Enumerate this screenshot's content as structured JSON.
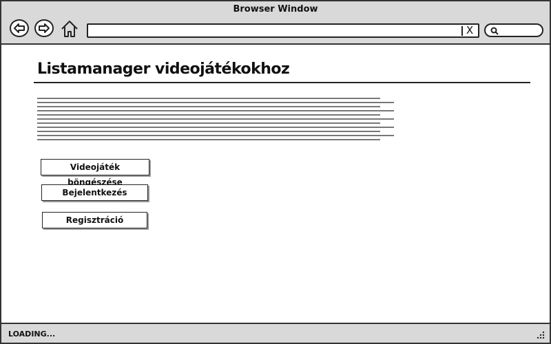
{
  "window": {
    "title": "Browser Window"
  },
  "toolbar": {
    "back_icon": "back-arrow-icon",
    "forward_icon": "forward-arrow-icon",
    "home_icon": "home-icon",
    "address_value": "",
    "clear_label": "X",
    "search_icon": "search-icon"
  },
  "page": {
    "heading": "Listamanager videojátékokhoz",
    "buttons": [
      {
        "label": "Videojáték böngészése"
      },
      {
        "label": "Bejelentkezés"
      },
      {
        "label": "Regisztráció"
      }
    ]
  },
  "status": {
    "text": "LOADING..."
  }
}
